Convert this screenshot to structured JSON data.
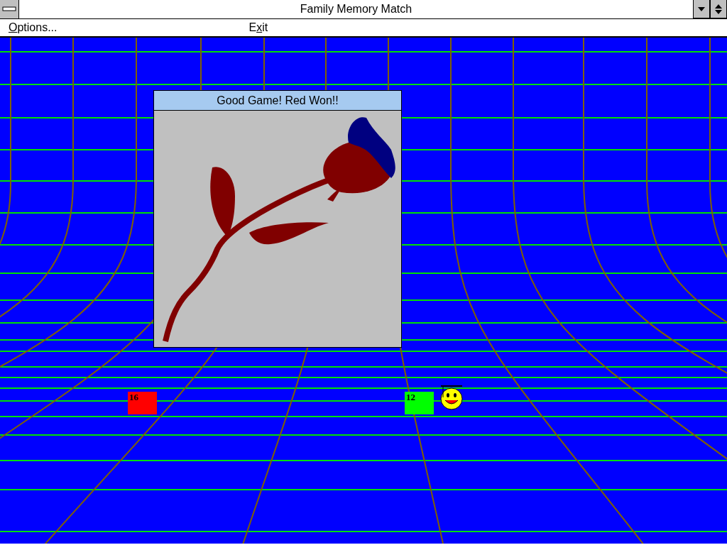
{
  "window": {
    "title": "Family Memory Match"
  },
  "menu": [
    {
      "key": "O",
      "after": "ptions..."
    },
    {
      "before": "E",
      "key": "x",
      "after": "it"
    }
  ],
  "dialog": {
    "title": "Good Game! Red Won!!"
  },
  "players": [
    {
      "score": "16",
      "color": "#ff0000",
      "current": false
    },
    {
      "score": "12",
      "color": "#00ff00",
      "current": true
    }
  ]
}
